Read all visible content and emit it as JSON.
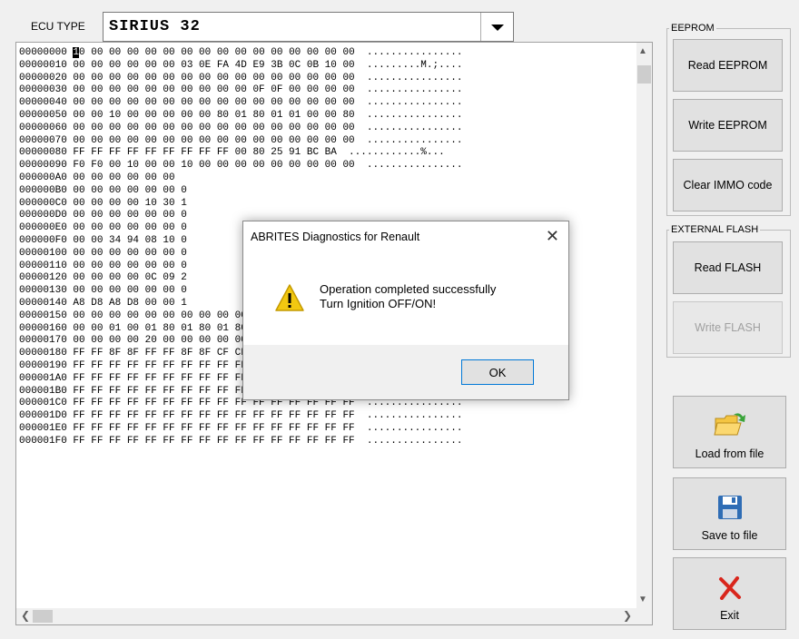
{
  "ecu": {
    "label": "ECU TYPE",
    "value": "SIRIUS 32"
  },
  "hex": {
    "caret_char": "1",
    "rows": [
      "00000000 |1|0 00 00 00 00 00 00 00 00 00 00 00 00 00 00 00  ................",
      "00000010 00 00 00 00 00 00 03 0E FA 4D E9 3B 0C 0B 10 00  .........M.;....",
      "00000020 00 00 00 00 00 00 00 00 00 00 00 00 00 00 00 00  ................",
      "00000030 00 00 00 00 00 00 00 00 00 00 0F 0F 00 00 00 00  ................",
      "00000040 00 00 00 00 00 00 00 00 00 00 00 00 00 00 00 00  ................",
      "00000050 00 00 10 00 00 00 00 00 80 01 80 01 01 00 00 80  ................",
      "00000060 00 00 00 00 00 00 00 00 00 00 00 00 00 00 00 00  ................",
      "00000070 00 00 00 00 00 00 00 00 00 00 00 00 00 00 00 00  ................",
      "00000080 FF FF FF FF FF FF FF FF FF 00 80 25 91 BC BA  ............%...",
      "00000090 F0 F0 00 10 00 00 10 00 00 00 00 00 00 00 00 00  ................",
      "000000A0 00 00 00 00 00 00",
      "000000B0 00 00 00 00 00 00 0",
      "000000C0 00 00 00 00 10 30 1",
      "000000D0 00 00 00 00 00 00 0",
      "000000E0 00 00 00 00 00 00 0",
      "000000F0 00 00 34 94 08 10 0",
      "00000100 00 00 00 00 00 00 0",
      "00000110 00 00 00 00 00 00 0",
      "00000120 00 00 00 00 0C 09 2",
      "00000130 00 00 00 00 00 00 0",
      "00000140 A8 D8 A8 D8 00 00 1",
      "00000150 00 00 00 00 00 00 00 00 00 00 00 00 01 80 00 00  ................",
      "00000160 00 00 01 00 01 80 01 80 01 80 01 80 00 80 00 00  ................",
      "00000170 00 00 00 00 20 00 00 00 00 00 00 00 E6 0B 00 00  .... ...........",
      "00000180 FF FF 8F 8F FF FF 8F 8F CF CF CF CF FF FF FF FF  ................",
      "00000190 FF FF FF FF FF FF FF FF FF FF FF FF FF FF FF FF  ................",
      "000001A0 FF FF FF FF FF FF FF FF FF FF FF FF FF FF FF FF  ................",
      "000001B0 FF FF FF FF FF FF FF FF FF FF FF FF FF FF FF FF  ................",
      "000001C0 FF FF FF FF FF FF FF FF FF FF FF FF FF FF FF FF  ................",
      "000001D0 FF FF FF FF FF FF FF FF FF FF FF FF FF FF FF FF  ................",
      "000001E0 FF FF FF FF FF FF FF FF FF FF FF FF FF FF FF FF  ................",
      "000001F0 FF FF FF FF FF FF FF FF FF FF FF FF FF FF FF FF  ................"
    ]
  },
  "eeprom": {
    "legend": "EEPROM",
    "read": "Read EEPROM",
    "write": "Write EEPROM",
    "clear": "Clear IMMO code"
  },
  "flash": {
    "legend": "EXTERNAL FLASH",
    "read": "Read FLASH",
    "write": "Write FLASH"
  },
  "file": {
    "load": "Load from file",
    "save": "Save to file",
    "exit": "Exit"
  },
  "dialog": {
    "title": "ABRITES Diagnostics for Renault",
    "line1": "Operation completed successfully",
    "line2": "Turn Ignition OFF/ON!",
    "ok": "OK"
  },
  "colors": {
    "accent": "#0078d7",
    "warning_yellow": "#f2c811",
    "exit_red": "#d9261c",
    "save_blue": "#2f6db5"
  }
}
